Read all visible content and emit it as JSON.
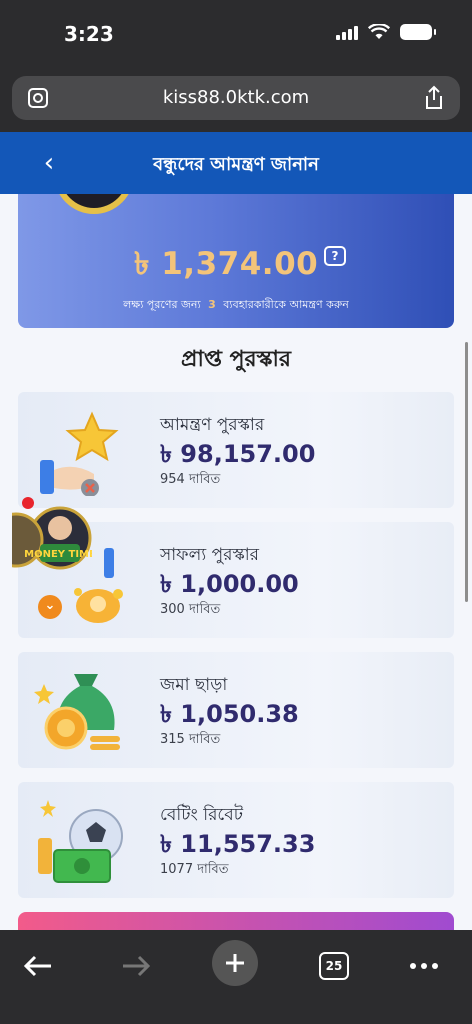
{
  "status_bar": {
    "time": "3:23"
  },
  "browser": {
    "url": "kiss88.0ktk.com"
  },
  "header": {
    "back": "‹",
    "title": "বন্ধুদের আমন্ত্রণ জানান"
  },
  "hero": {
    "amount": "৳ 1,374.00",
    "help": "?",
    "note_before": "লক্ষ্য পূরণের জন্য",
    "note_count": "3",
    "note_after": "ব্যবহারকারীকে আমন্ত্রণ করুন"
  },
  "section_title": "প্রাপ্ত পুরস্কার",
  "rewards": [
    {
      "title": "আমন্ত্রণ পুরস্কার",
      "amount": "৳ 98,157.00",
      "claims": "954 দাবিত"
    },
    {
      "title": "সাফল্য পুরস্কার",
      "amount": "৳ 1,000.00",
      "claims": "300 দাবিত"
    },
    {
      "title": "জমা ছাড়া",
      "amount": "৳ 1,050.38",
      "claims": "315 দাবিত"
    },
    {
      "title": "বেটিং রিবেট",
      "amount": "৳ 11,557.33",
      "claims": "1077 দাবিত"
    }
  ],
  "float_widget": {
    "label": "MONEY TIME"
  },
  "toolbar": {
    "tabs_count": "25"
  },
  "colors": {
    "header_bg": "#1357b8",
    "hero_gold": "#f3c47a",
    "amount_text": "#302b6e"
  }
}
